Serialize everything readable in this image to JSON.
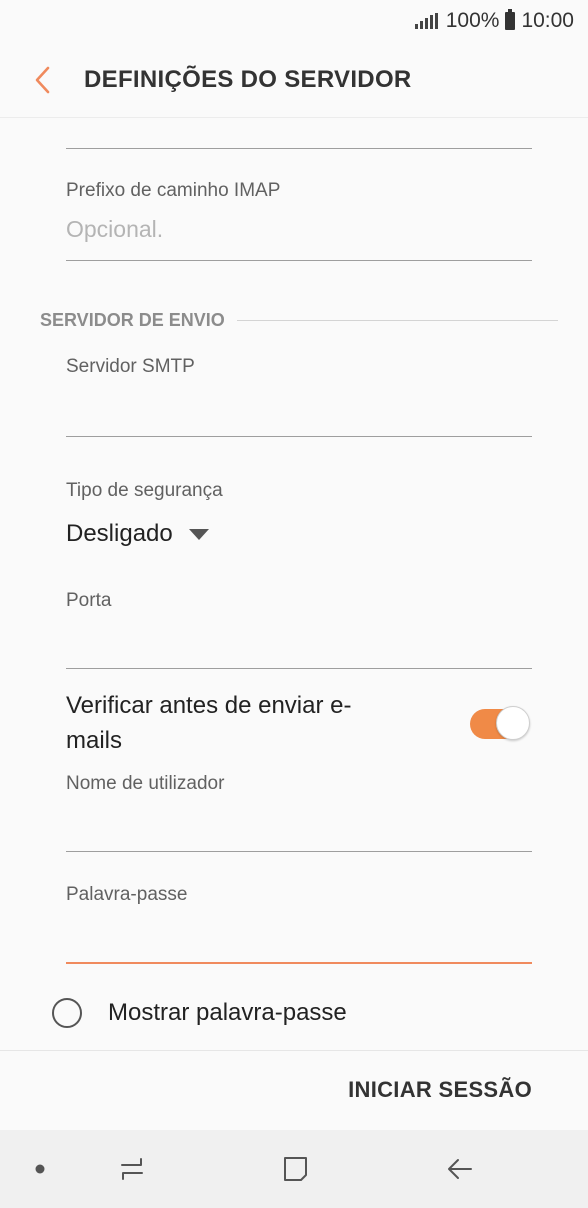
{
  "status_bar": {
    "battery": "100%",
    "time": "10:00"
  },
  "header": {
    "title": "DEFINIÇÕES DO SERVIDOR",
    "back_icon": "chevron-left-icon",
    "accent_color": "#f08a5d"
  },
  "incoming": {
    "imap_prefix": {
      "label": "Prefixo de caminho IMAP",
      "placeholder": "Opcional."
    }
  },
  "outgoing": {
    "section_title": "SERVIDOR DE ENVIO",
    "smtp_server": {
      "label": "Servidor SMTP",
      "value": ""
    },
    "security_type": {
      "label": "Tipo de segurança",
      "value": "Desligado"
    },
    "port": {
      "label": "Porta",
      "value": ""
    },
    "verify_before_send": {
      "label": "Verificar antes de enviar e-mails",
      "enabled": true
    },
    "username": {
      "label": "Nome de utilizador",
      "value": ""
    },
    "password": {
      "label": "Palavra-passe",
      "value": ""
    },
    "show_password": {
      "label": "Mostrar palavra-passe",
      "checked": false
    }
  },
  "footer": {
    "sign_in_label": "INICIAR SESSÃO"
  },
  "nav_bar": {
    "items": [
      "dot-icon",
      "recents-icon",
      "home-icon",
      "back-icon"
    ]
  }
}
